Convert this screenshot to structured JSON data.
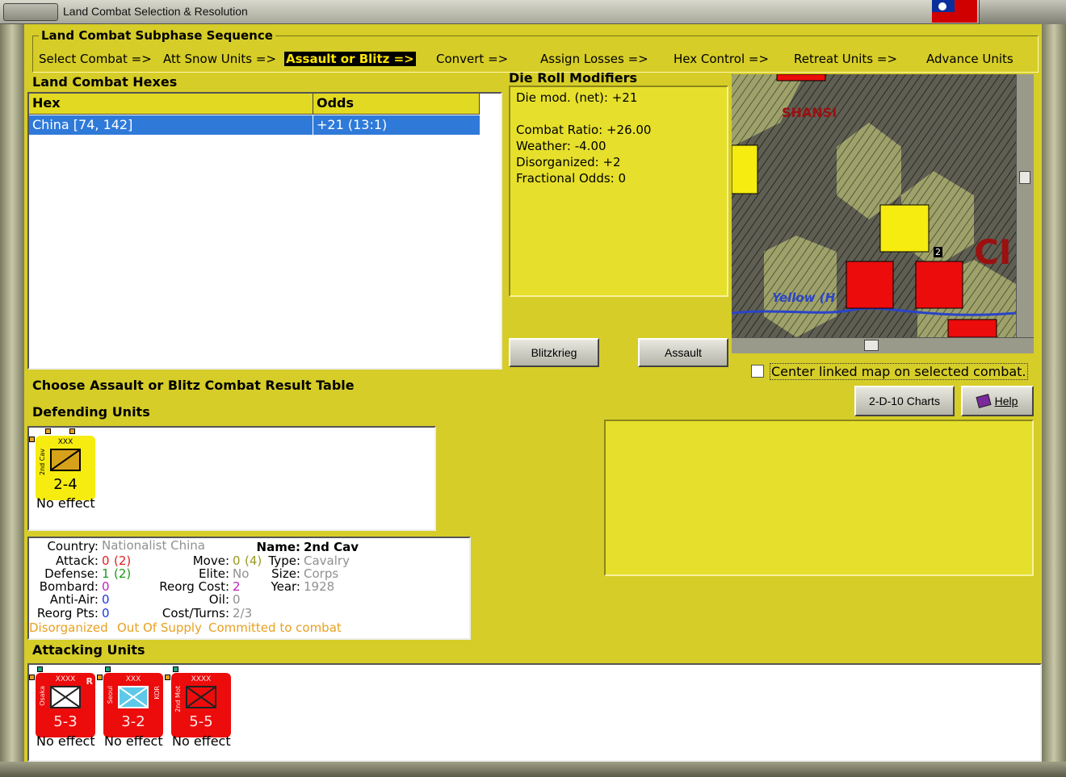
{
  "window": {
    "title": "Land Combat Selection & Resolution"
  },
  "sequence": {
    "title": "Land Combat Subphase Sequence",
    "steps": [
      "Select Combat =>",
      "Att Snow Units =>",
      "Assault or Blitz =>",
      "Convert =>",
      "Assign Losses =>",
      "Hex Control =>",
      "Retreat Units =>",
      "Advance Units"
    ]
  },
  "hexes": {
    "title": "Land Combat Hexes",
    "columns": [
      "Hex",
      "Odds"
    ],
    "rows": [
      {
        "hex": "China [74, 142]",
        "odds": "+21 (13:1)"
      }
    ]
  },
  "drm": {
    "title": "Die Roll Modifiers",
    "net": "Die mod. (net): +21",
    "lines": [
      "Combat Ratio: +26.00",
      "Weather: -4.00",
      "Disorganized: +2",
      "Fractional Odds: 0"
    ]
  },
  "buttons": {
    "blitz": "Blitzkrieg",
    "assault": "Assault",
    "charts": "2-D-10 Charts",
    "help": "Help"
  },
  "map": {
    "region_label": "SHANSI",
    "river_label": "Yellow (H",
    "big_label": "CI",
    "hex_number": "2"
  },
  "center_linked": "Center linked map on selected combat.",
  "choose_crt": "Choose Assault or Blitz Combat Result Table",
  "defending": {
    "title": "Defending Units",
    "units": [
      {
        "name": "2nd Cav",
        "size": "XXX",
        "strength": "2-4",
        "result": "No effect"
      }
    ]
  },
  "info": {
    "country_k": "Country:",
    "country_v": "Nationalist China",
    "attack_k": "Attack:",
    "attack_v": "0",
    "attack_p": "(2)",
    "defense_k": "Defense:",
    "defense_v": "1",
    "defense_p": "(2)",
    "bombard_k": "Bombard:",
    "bombard_v": "0",
    "antiair_k": "Anti-Air:",
    "antiair_v": "0",
    "reorgpts_k": "Reorg Pts:",
    "reorgpts_v": "0",
    "move_k": "Move:",
    "move_v": "0",
    "move_p": "(4)",
    "elite_k": "Elite:",
    "elite_v": "No",
    "reorgcost_k": "Reorg Cost:",
    "reorgcost_v": "2",
    "oil_k": "Oil:",
    "oil_v": "0",
    "costturns_k": "Cost/Turns:",
    "costturns_v": "2/3",
    "name_k": "Name:",
    "name_v": "2nd Cav",
    "type_k": "Type:",
    "type_v": "Cavalry",
    "size_k": "Size:",
    "size_v": "Corps",
    "year_k": "Year:",
    "year_v": "1928",
    "status_a": "Disorganized",
    "status_b": "Out Of Supply",
    "status_c": "Committed to combat"
  },
  "attacking": {
    "title": "Attacking Units",
    "units": [
      {
        "name": "Osaka",
        "size": "XXXX",
        "mark": "R",
        "strength": "5-3",
        "result": "No effect"
      },
      {
        "name": "Seoul",
        "size": "XXX",
        "mark": "KOR",
        "strength": "3-2",
        "result": "No effect"
      },
      {
        "name": "2nd Mot",
        "size": "XXXX",
        "mark": "",
        "strength": "5-5",
        "result": "No effect"
      }
    ]
  },
  "colors": {
    "panel": "#d6cd28",
    "selection": "#2f7ad9",
    "unit_red": "#ec0c0c",
    "unit_yellow": "#f6ec10"
  }
}
